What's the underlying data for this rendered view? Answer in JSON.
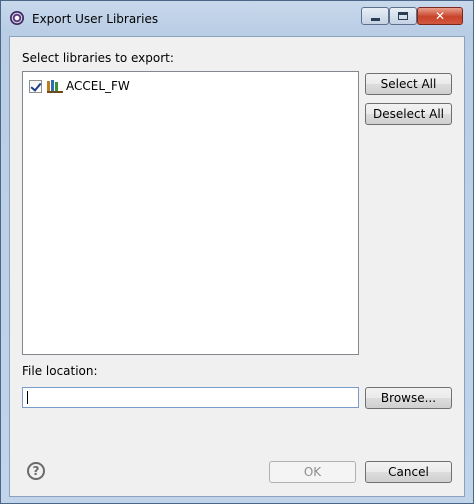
{
  "window": {
    "title": "Export User Libraries",
    "controls": {
      "minimize": "minimize",
      "maximize": "maximize",
      "close": "✕"
    }
  },
  "libraries": {
    "label": "Select libraries to export:",
    "items": [
      {
        "label": "ACCEL_FW",
        "checked": true
      }
    ],
    "select_all": "Select All",
    "deselect_all": "Deselect All"
  },
  "file_location": {
    "label": "File location:",
    "value": "",
    "browse": "Browse..."
  },
  "footer": {
    "help": "?",
    "ok": "OK",
    "cancel": "Cancel",
    "ok_enabled": false
  }
}
